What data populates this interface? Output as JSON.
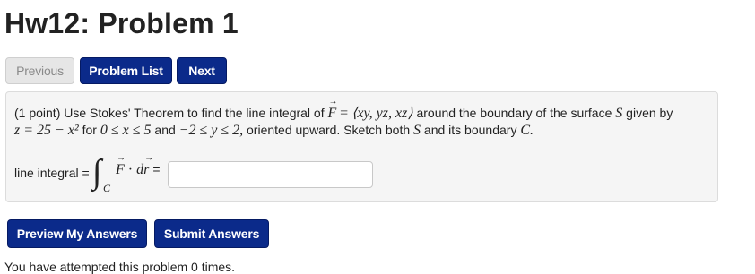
{
  "page": {
    "title": "Hw12: Problem 1"
  },
  "nav": {
    "previous_label": "Previous",
    "problem_list_label": "Problem List",
    "next_label": "Next"
  },
  "problem": {
    "points": "(1 point)",
    "intro": "Use Stokes' Theorem to find the line integral of",
    "field_symbol": "F",
    "equals": "=",
    "field_expr": "⟨xy, yz, xz⟩",
    "around_text": "around the boundary of the surface",
    "surface_symbol": "S",
    "given_by": "given by",
    "surface_eq": "z = 25 − x²",
    "for_text": "for",
    "x_range": "0 ≤ x ≤ 5",
    "and_text": "and",
    "y_range": "−2 ≤ y ≤ 2,",
    "oriented_text": "oriented upward. Sketch both",
    "surface_symbol_2": "S",
    "and_boundary_text": "and its boundary",
    "boundary_symbol": "C.",
    "answer_label": "line integral =",
    "integral_sign": "∫",
    "integral_sub": "C",
    "integral_F": "F",
    "integral_dot": "·",
    "integral_d": "d",
    "integral_r": "r",
    "integral_equals": "=",
    "answer_value": "",
    "answer_placeholder": ""
  },
  "actions": {
    "preview_label": "Preview My Answers",
    "submit_label": "Submit Answers"
  },
  "footer": {
    "attempts_text": "You have attempted this problem 0 times."
  },
  "colors": {
    "primary_button": "#0b2a8a",
    "disabled_button": "#e6e6e6",
    "problem_background": "#f5f5f5"
  }
}
